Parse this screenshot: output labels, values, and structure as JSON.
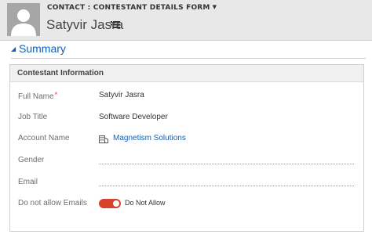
{
  "header": {
    "form_selector": "CONTACT : CONTESTANT DETAILS FORM",
    "record_name": "Satyvir Jasra",
    "avatar_icon": "person-silhouette-icon",
    "more_icon": "list-menu-icon"
  },
  "section": {
    "title": "Summary",
    "toggle_icon": "collapse-triangle-icon"
  },
  "panel": {
    "title": "Contestant Information",
    "fields": [
      {
        "label": "Full Name",
        "value": "Satyvir Jasra",
        "required": true
      },
      {
        "label": "Job Title",
        "value": "Software Developer"
      },
      {
        "label": "Account Name",
        "value": "Magnetism Solutions",
        "icon": "account-building-icon"
      },
      {
        "label": "Gender",
        "value": ""
      },
      {
        "label": "Email",
        "value": ""
      },
      {
        "label": "Do not allow Emails",
        "value": "Do Not Allow"
      }
    ]
  },
  "colors": {
    "accent": "#1160b7",
    "toggle_on": "#d8442b",
    "required": "#e0302a"
  }
}
